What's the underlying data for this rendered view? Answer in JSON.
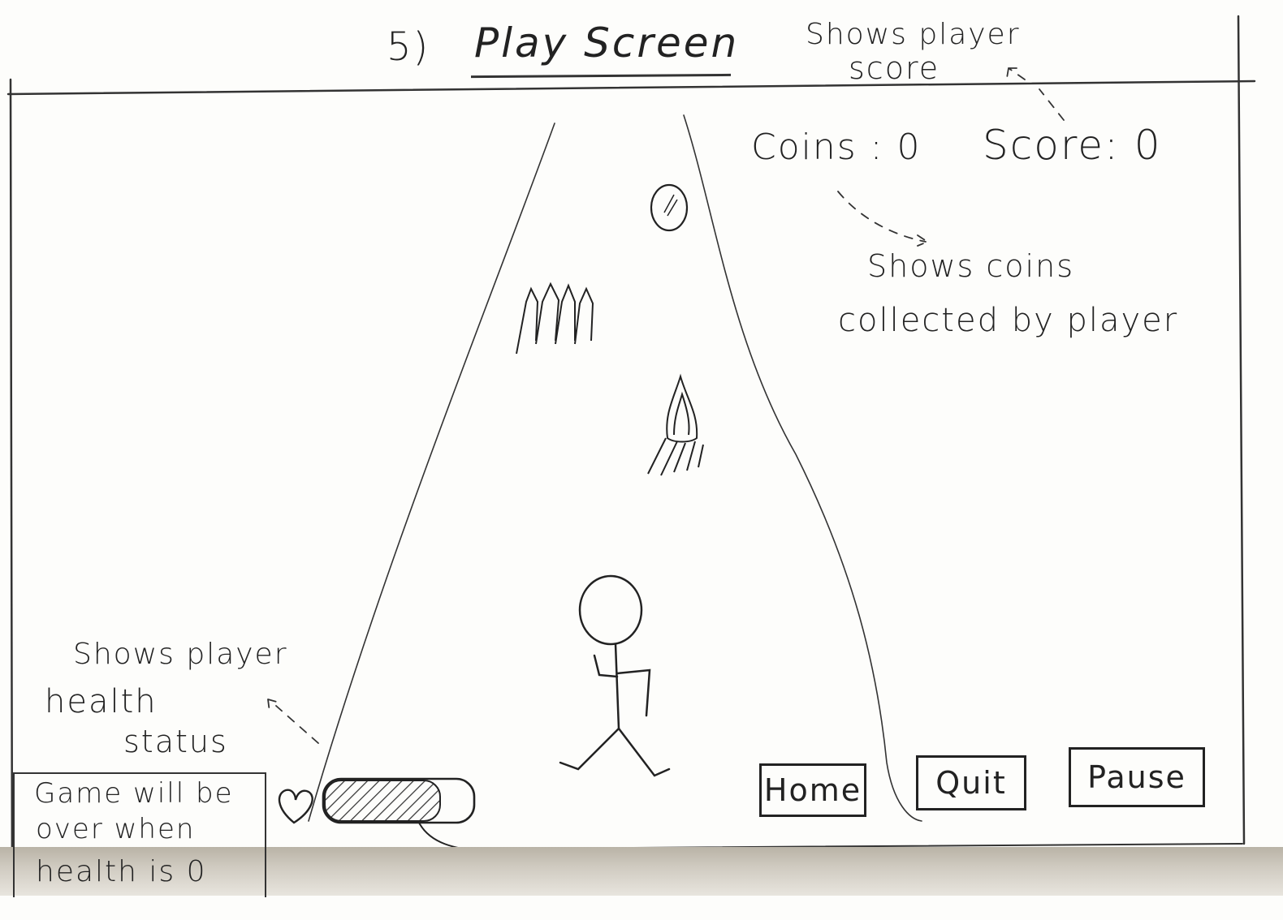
{
  "title": {
    "number": "5)",
    "text": "Play Screen"
  },
  "hud": {
    "coins_label": "Coins : 0",
    "score_label": "Score: 0",
    "coins_value": 0,
    "score_value": 0,
    "health_icon": "heart-icon"
  },
  "annotations": {
    "score_note_line1": "Shows player",
    "score_note_line2": "score",
    "coins_note_line1": "Shows coins",
    "coins_note_line2": "collected by player",
    "health_note_line1": "Shows player",
    "health_note_line2": "health",
    "health_note_line3": "status",
    "gameover_line1": "Game will be",
    "gameover_line2": "over when",
    "gameover_line3": "health is 0"
  },
  "buttons": {
    "home": "Home",
    "quit": "Quit",
    "pause": "Pause"
  },
  "game_objects": {
    "coin": "coin-icon",
    "obstacle_spikes": "spikes-obstacle",
    "obstacle_fire": "fire-obstacle",
    "player": "stick-figure-player"
  },
  "colors": {
    "ink": "#222222",
    "paper": "#fdfdfb"
  }
}
